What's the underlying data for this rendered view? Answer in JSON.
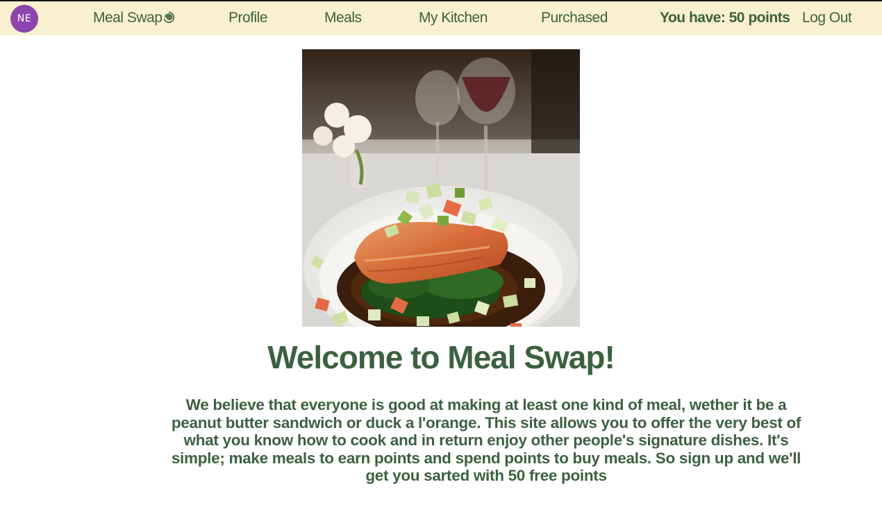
{
  "nav": {
    "avatar_initials": "NE",
    "brand_label": "Meal Swap",
    "brand_icon": "swirl-icon",
    "profile_label": "Profile",
    "meals_label": "Meals",
    "kitchen_label": "My Kitchen",
    "purchased_label": "Purchased",
    "points_text": "You have: 50 points",
    "logout_label": "Log Out"
  },
  "hero": {
    "image_description": "plated salmon fillet with greens and diced vegetable salsa on a white plate, wine glasses in background"
  },
  "main": {
    "heading": "Welcome to Meal Swap!",
    "intro": "We believe that everyone is good at making at least one kind of meal, wether it be a peanut butter sandwich or duck a l'orange. This site allows you to offer the very best of what you know how to cook and in return enjoy other people's signature dishes. It's simple; make meals to earn points and spend points to buy meals. So sign up and we'll get you sarted with 50 free points"
  },
  "colors": {
    "nav_background": "#f9f0cf",
    "text_green": "#3c6140",
    "avatar_purple": "#8e44ad"
  }
}
